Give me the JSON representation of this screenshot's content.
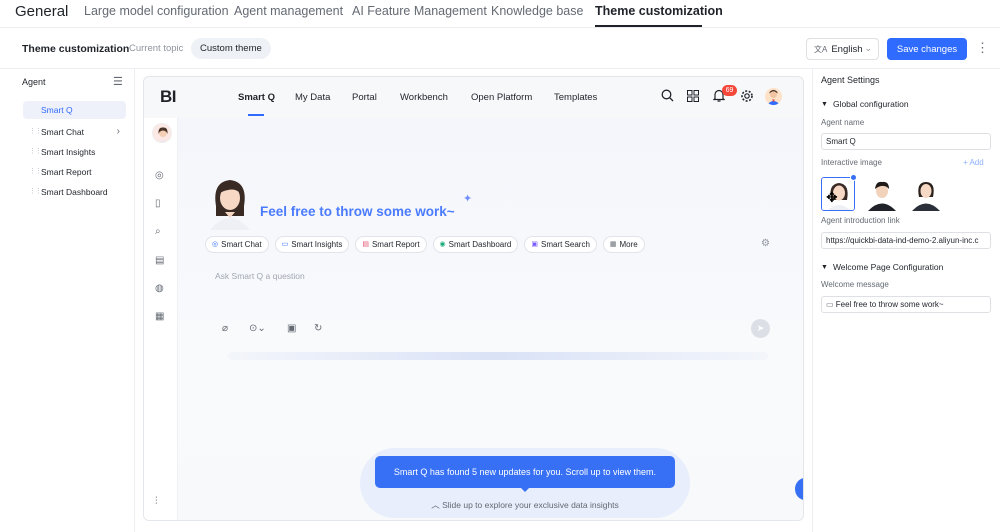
{
  "topnav": {
    "brand": "General",
    "tabs": [
      "Large model configuration",
      "Agent management",
      "AI Feature Management",
      "Knowledge base",
      "Theme customization"
    ],
    "active_tab": "Theme customization"
  },
  "subheader": {
    "title": "Theme customization",
    "current_topic": "Current topic",
    "custom_theme": "Custom theme",
    "language": "English",
    "save_label": "Save changes",
    "more_glyph": "⋮"
  },
  "sidebar": {
    "header": "Agent",
    "items": [
      {
        "label": "Smart Q",
        "selected": true
      },
      {
        "label": "Smart Chat",
        "has_children": true
      },
      {
        "label": "Smart Insights"
      },
      {
        "label": "Smart Report"
      },
      {
        "label": "Smart Dashboard"
      }
    ]
  },
  "preview": {
    "logo": "BI",
    "nav": [
      "Smart Q",
      "My Data",
      "Portal",
      "Workbench",
      "Open Platform",
      "Templates"
    ],
    "active_nav": "Smart Q",
    "notification_count": "69",
    "greeting": "Feel free to throw some work~",
    "chips": [
      {
        "label": "Smart Chat",
        "icon": "chat-icon",
        "color": "#2f6bff"
      },
      {
        "label": "Smart Insights",
        "icon": "insights-icon",
        "color": "#2f6bff"
      },
      {
        "label": "Smart Report",
        "icon": "report-icon",
        "color": "#e0506b"
      },
      {
        "label": "Smart Dashboard",
        "icon": "dashboard-icon",
        "color": "#19a97b"
      },
      {
        "label": "Smart Search",
        "icon": "search-icon",
        "color": "#7a5cff"
      },
      {
        "label": "More",
        "icon": "grid-icon",
        "color": "#646a73"
      }
    ],
    "input_placeholder": "Ask Smart Q a question",
    "toast": "Smart Q has found 5 new updates for you. Scroll up to view them.",
    "slide_hint": "Slide up to explore your exclusive data insights"
  },
  "settings": {
    "title": "Agent Settings",
    "global_section": "Global configuration",
    "agent_name_label": "Agent name",
    "agent_name_value": "Smart Q",
    "interactive_image_label": "Interactive image",
    "add_label": "+ Add",
    "intro_link_label": "Agent introduction link",
    "intro_link_value": "https://quickbi-data-ind-demo-2.aliyun-inc.c",
    "welcome_section": "Welcome Page Configuration",
    "welcome_message_label": "Welcome message",
    "welcome_message_value": "Feel free to throw some work~"
  },
  "colors": {
    "accent": "#2f6bff",
    "toast": "#3770f5",
    "badge": "#f5483b",
    "greeting": "#4b7bff"
  }
}
